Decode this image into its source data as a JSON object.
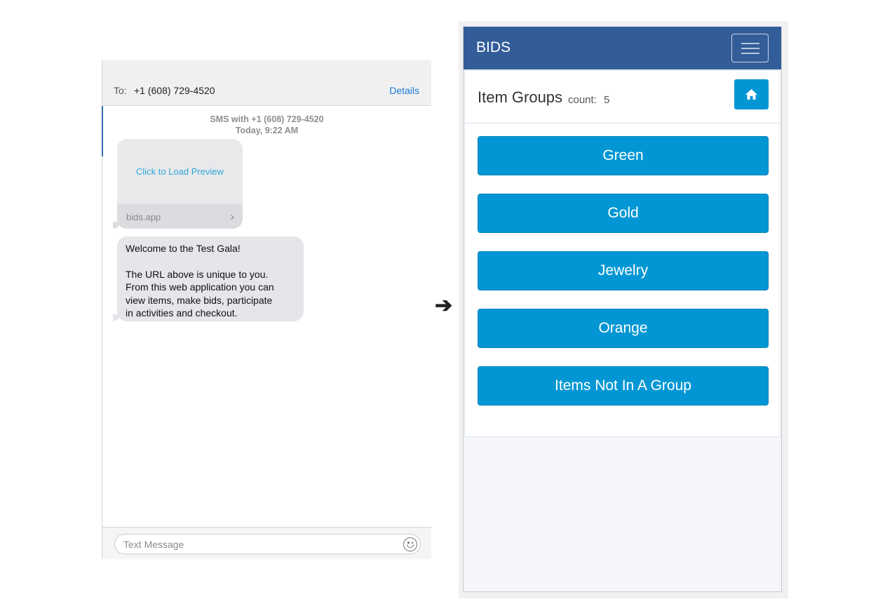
{
  "messages": {
    "to_label": "To:",
    "to_number": "+1 (608) 729-4520",
    "details_label": "Details",
    "meta_line1": "SMS with +1 (608) 729-4520",
    "meta_line2": "Today, 9:22 AM",
    "preview_link": "Click to Load Preview",
    "preview_domain": "bids.app",
    "preview_chevron": "›",
    "bubble_lines": [
      "Welcome to the Test Gala!",
      "",
      "The URL above is unique to you.",
      "From this web application you can",
      "view items, make bids, participate",
      "in activities and checkout."
    ],
    "input_placeholder": "Text Message",
    "emoji_icon": "smiley-icon"
  },
  "arrow": "➔",
  "app": {
    "brand": "BIDS",
    "menu_icon": "hamburger-icon",
    "heading_title": "Item Groups",
    "count_label": "count:",
    "count_value": "5",
    "home_icon": "home-icon",
    "groups": [
      {
        "label": "Green"
      },
      {
        "label": "Gold"
      },
      {
        "label": "Jewelry"
      },
      {
        "label": "Orange"
      },
      {
        "label": "Items Not In A Group"
      }
    ]
  },
  "colors": {
    "navbar": "#335d99",
    "button": "#0297d4",
    "link_blue": "#1a7bd5",
    "bubble_gray": "#e5e5ea"
  }
}
